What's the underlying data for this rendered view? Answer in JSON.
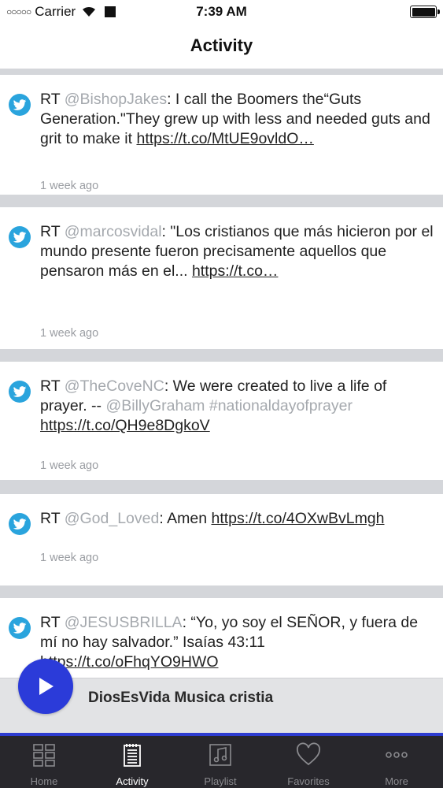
{
  "status_bar": {
    "carrier": "Carrier",
    "time": "7:39 AM"
  },
  "nav": {
    "title": "Activity"
  },
  "feed": [
    {
      "prefix": "RT ",
      "handle": "@BishopJakes",
      "text": ": I call the Boomers the“Guts Generation.\"They grew up with less and needed guts and grit to make it ",
      "link": "https://t.co/MtUE9ovldO…",
      "time": "1 week ago"
    },
    {
      "prefix": "RT ",
      "handle": "@marcosvidal",
      "text": ": \"Los cristianos que más hicieron por el mundo presente fueron precisamente aquellos que pensaron más en el... ",
      "link": "https://t.co…",
      "time": "1 week ago"
    },
    {
      "prefix": "RT ",
      "handle": "@TheCoveNC",
      "text": ": We were created to live a life of prayer. -- ",
      "handle2": "@BillyGraham",
      "hashtag": "#nationaldayofprayer",
      "link": "https://t.co/QH9e8DgkoV",
      "time": "1 week ago"
    },
    {
      "prefix": "RT ",
      "handle": "@God_Loved",
      "text": ": Amen ",
      "link": "https://t.co/4OXwBvLmgh",
      "time": "1 week ago"
    },
    {
      "prefix": "RT ",
      "handle": "@JESUSBRILLA",
      "text": ": “Yo, yo soy el SEÑOR, y fuera de mí no hay salvador.” Isaías 43:11 ",
      "link": "https://t.co/oFhqYO9HWO",
      "time": ""
    }
  ],
  "player": {
    "title": "DiosEsVida Musica cristia"
  },
  "tabs": [
    {
      "label": "Home",
      "icon": "grid-icon"
    },
    {
      "label": "Activity",
      "icon": "notepad-icon"
    },
    {
      "label": "Playlist",
      "icon": "music-note-icon"
    },
    {
      "label": "Favorites",
      "icon": "heart-icon"
    },
    {
      "label": "More",
      "icon": "more-dots-icon"
    }
  ],
  "colors": {
    "accent": "#2b3bd9",
    "twitter": "#2aa4dd",
    "tab_bg": "#28272c"
  }
}
